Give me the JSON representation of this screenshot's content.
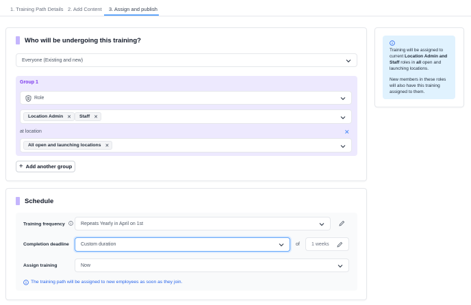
{
  "tabs": [
    {
      "label": "1. Training Path Details"
    },
    {
      "label": "2. Add Content"
    },
    {
      "label": "3. Assign and publish"
    }
  ],
  "who": {
    "title": "Who will be undergoing this training?",
    "audience_select": "Everyone (Existing and new)",
    "group": {
      "label": "Group 1",
      "role_select": "Role",
      "role_chips": [
        "Location Admin",
        "Staff"
      ],
      "location_prefix": "at location",
      "location_chips": [
        "All open and launching locations"
      ]
    },
    "add_group_button": "Add another group"
  },
  "schedule": {
    "title": "Schedule",
    "frequency_label": "Training frequency",
    "frequency_value": "Repeats Yearly in April on 1st",
    "deadline_label": "Completion deadline",
    "deadline_value": "Custom duration",
    "deadline_of": "of",
    "deadline_weeks": "1 weeks",
    "assign_label": "Assign training",
    "assign_value": "Now",
    "note": "The training path will be assigned to new employees as soon as they join."
  },
  "info": {
    "p1_a": "Training will be assigned to current ",
    "p1_b": "Location Admin and Staff",
    "p1_c": " roles in ",
    "p1_d": "all",
    "p1_e": " open and launching locations.",
    "p2": "New members in these roles will also have this training assigned to them."
  },
  "colors": {
    "accent": "#c4b5fd",
    "group_bg": "#ede9fe",
    "group_label": "#7c3aed",
    "tab_underline": "#60a5fa",
    "info_bg": "#e0f2fe",
    "note_blue": "#2563eb"
  },
  "icons": [
    "shield-user-icon",
    "chevron-down-icon",
    "close-icon",
    "plus-icon",
    "info-icon",
    "pencil-icon"
  ]
}
